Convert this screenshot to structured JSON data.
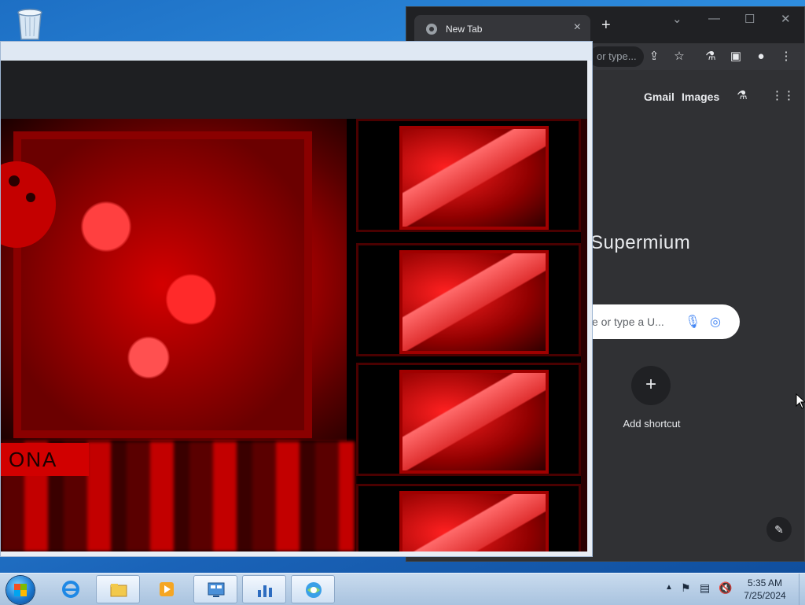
{
  "desktop": {
    "recycle_bin_icon": "recycle-bin-icon"
  },
  "browser": {
    "tab_title": "New Tab",
    "omnibox_text": "or type...",
    "top_links": [
      "Gmail",
      "Images"
    ],
    "logo_text": "Supermium",
    "search_placeholder": "e or type a U...",
    "shortcut_label": "Add shortcut",
    "shortcut_plus": "+",
    "new_tab_plus": "+",
    "tab_close": "×"
  },
  "video_player": {
    "caption_text": "ONA"
  },
  "taskbar": {
    "time": "5:35 AM",
    "date": "7/25/2024"
  }
}
